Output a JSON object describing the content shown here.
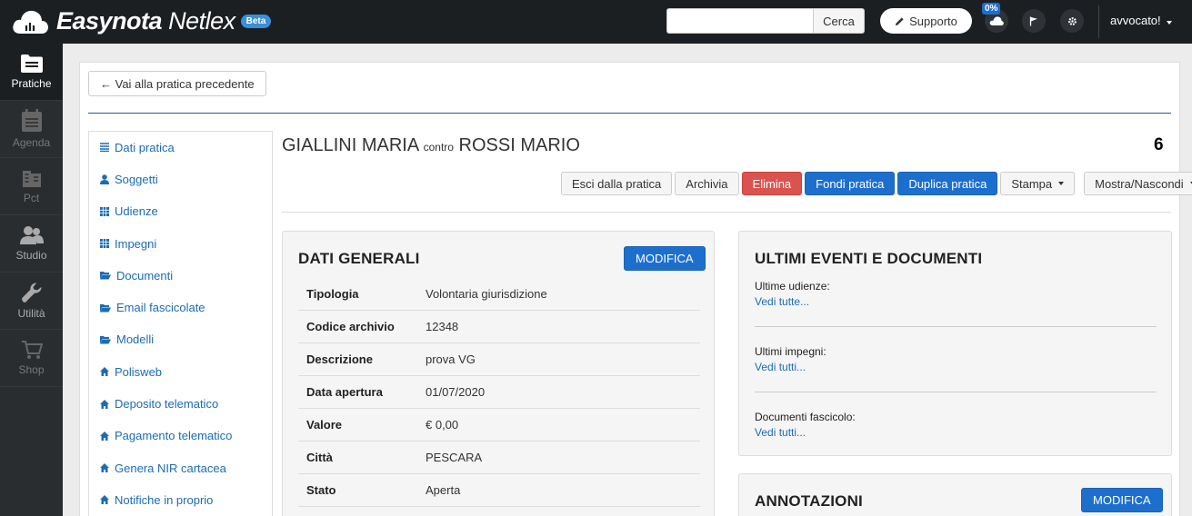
{
  "header": {
    "brand_bold": "Easynota",
    "brand_light": "Netlex",
    "beta": "Beta",
    "search_placeholder": "",
    "search_button": "Cerca",
    "support_button": "Supporto",
    "cloud_percent": "0%",
    "user_menu": "avvocato!"
  },
  "leftnav": [
    {
      "label": "Pratiche",
      "icon": "folder-icon"
    },
    {
      "label": "Agenda",
      "icon": "calendar-icon"
    },
    {
      "label": "Pct",
      "icon": "building-icon"
    },
    {
      "label": "Studio",
      "icon": "users-icon"
    },
    {
      "label": "Utilità",
      "icon": "wrench-icon"
    },
    {
      "label": "Shop",
      "icon": "cart-icon"
    }
  ],
  "back_button": "← Vai alla pratica precedente",
  "sidemenu": [
    {
      "label": "Dati pratica",
      "icon": "list-icon"
    },
    {
      "label": "Soggetti",
      "icon": "user-icon"
    },
    {
      "label": "Udienze",
      "icon": "grid-icon"
    },
    {
      "label": "Impegni",
      "icon": "grid-icon"
    },
    {
      "label": "Documenti",
      "icon": "folder-open-icon"
    },
    {
      "label": "Email fascicolate",
      "icon": "folder-open-icon"
    },
    {
      "label": "Modelli",
      "icon": "folder-open-icon"
    },
    {
      "label": "Polisweb",
      "icon": "home-icon"
    },
    {
      "label": "Deposito telematico",
      "icon": "home-icon"
    },
    {
      "label": "Pagamento telematico",
      "icon": "home-icon"
    },
    {
      "label": "Genera NIR cartacea",
      "icon": "home-icon"
    },
    {
      "label": "Notifiche in proprio",
      "icon": "home-icon"
    }
  ],
  "pratica": {
    "party_a": "GIALLINI MARIA",
    "contro": "contro",
    "party_b": "ROSSI MARIO",
    "number": "6"
  },
  "toolbar": {
    "esci": "Esci dalla pratica",
    "archivia": "Archivia",
    "elimina": "Elimina",
    "fondi": "Fondi pratica",
    "duplica": "Duplica pratica",
    "stampa": "Stampa",
    "mostra": "Mostra/Nascondi"
  },
  "dati_generali": {
    "title": "DATI GENERALI",
    "modifica": "MODIFICA",
    "rows": [
      {
        "label": "Tipologia",
        "value": "Volontaria giurisdizione"
      },
      {
        "label": "Codice archivio",
        "value": "12348"
      },
      {
        "label": "Descrizione",
        "value": "prova VG"
      },
      {
        "label": "Data apertura",
        "value": "01/07/2020"
      },
      {
        "label": "Valore",
        "value": "€ 0,00"
      },
      {
        "label": "Città",
        "value": "PESCARA"
      },
      {
        "label": "Stato",
        "value": "Aperta"
      }
    ]
  },
  "ultimi_eventi": {
    "title": "ULTIMI EVENTI E DOCUMENTI",
    "blocks": [
      {
        "label": "Ultime udienze:",
        "link": "Vedi tutte..."
      },
      {
        "label": "Ultimi impegni:",
        "link": "Vedi tutti..."
      },
      {
        "label": "Documenti fascicolo:",
        "link": "Vedi tutti..."
      }
    ]
  },
  "annotazioni": {
    "title": "ANNOTAZIONI",
    "modifica": "MODIFICA"
  },
  "colors": {
    "topbar": "#1c1f22",
    "accent_blue": "#1d6fce",
    "danger_red": "#d9534f",
    "link_blue": "#1c6bb5"
  }
}
